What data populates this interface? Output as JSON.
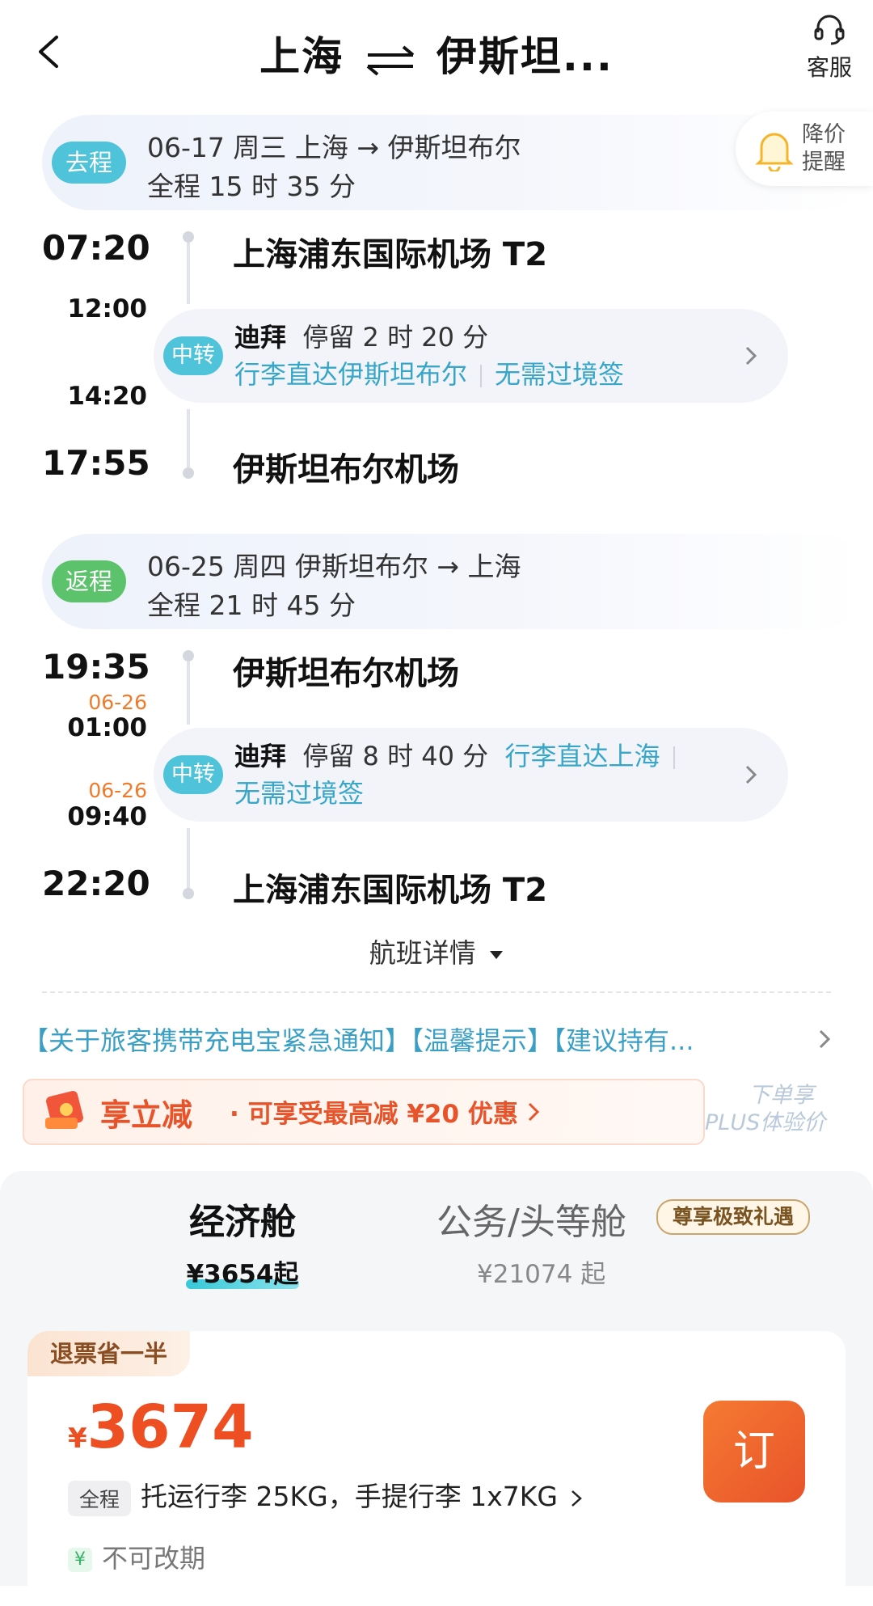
{
  "header": {
    "title_from": "上海",
    "title_to": "伊斯坦...",
    "service_label": "客服"
  },
  "price_alert": {
    "line1": "降价",
    "line2": "提醒"
  },
  "outbound": {
    "badge": "去程",
    "line1": "06-17 周三   上海 → 伊斯坦布尔",
    "line2": "全程 15 时 35 分",
    "depart_time": "07:20",
    "depart_airport": "上海浦东国际机场 T2",
    "transfer_arrive": "12:00",
    "transfer_depart": "14:20",
    "transfer_badge": "中转",
    "transfer_city": "迪拜",
    "transfer_stay": "停留 2 时 20 分",
    "transfer_baggage": "行李直达伊斯坦布尔",
    "transfer_visa": "无需过境签",
    "arrive_time": "17:55",
    "arrive_airport": "伊斯坦布尔机场"
  },
  "return": {
    "badge": "返程",
    "line1": "06-25 周四   伊斯坦布尔 → 上海",
    "line2": "全程 21 时 45 分",
    "depart_time": "19:35",
    "depart_airport": "伊斯坦布尔机场",
    "transfer_arrive_date": "06-26",
    "transfer_arrive": "01:00",
    "transfer_depart_date": "06-26",
    "transfer_depart": "09:40",
    "transfer_badge": "中转",
    "transfer_city": "迪拜",
    "transfer_stay": "停留 8 时 40 分",
    "transfer_baggage": "行李直达上海",
    "transfer_visa": "无需过境签",
    "arrive_time": "22:20",
    "arrive_airport": "上海浦东国际机场 T2"
  },
  "flight_detail_label": "航班详情",
  "notices": "【关于旅客携带充电宝紧急通知】【温馨提示】【建议持有...",
  "promo": {
    "title": "享立减",
    "desc": "· 可享受最高减 ¥20 优惠",
    "plus_line1": "下单享",
    "plus_line2": "PLUS体验价"
  },
  "cabins": {
    "economy": {
      "label": "经济舱",
      "price": "¥3654起"
    },
    "business": {
      "label": "公务/头等舱",
      "price": "¥21074 起",
      "badge": "尊享极致礼遇"
    }
  },
  "offer": {
    "tag": "退票省一半",
    "currency": "¥",
    "price": "3674",
    "book_label": "订",
    "baggage_tag": "全程",
    "baggage": "托运行李 25KG，手提行李 1x7KG",
    "reschedule_icon": "¥",
    "reschedule": "不可改期"
  },
  "colors": {
    "accent_blue": "#37a6c8",
    "accent_orange": "#ee4f22",
    "outbound_badge": "#4ec3d9",
    "return_badge": "#5cc36c"
  }
}
